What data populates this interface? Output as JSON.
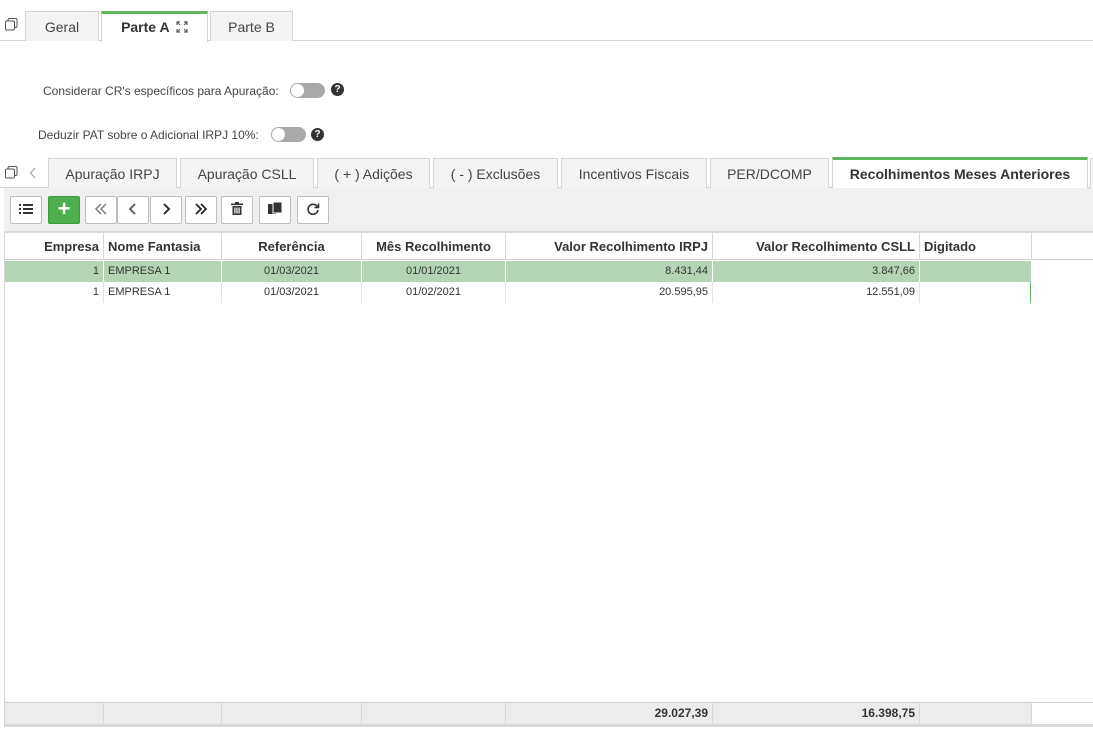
{
  "top_tabs": [
    {
      "label": "Geral",
      "active": false
    },
    {
      "label": "Parte A",
      "active": true
    },
    {
      "label": "Parte B",
      "active": false
    }
  ],
  "options": [
    {
      "label": "Considerar CR's específicos para Apuração:",
      "enabled": false
    },
    {
      "label": "Deduzir PAT sobre o Adicional IRPJ 10%:",
      "enabled": false
    }
  ],
  "help_glyph": "?",
  "sub_tabs": [
    {
      "label": "Apuração IRPJ",
      "active": false
    },
    {
      "label": "Apuração CSLL",
      "active": false
    },
    {
      "label": "( + ) Adições",
      "active": false
    },
    {
      "label": "( - ) Exclusões",
      "active": false
    },
    {
      "label": "Incentivos Fiscais",
      "active": false
    },
    {
      "label": "PER/DCOMP",
      "active": false
    },
    {
      "label": "Recolhimentos Meses Anteriores",
      "active": true
    }
  ],
  "toolbar": {
    "list_icon": "list-icon",
    "add_glyph": "+",
    "first_glyph": "«",
    "prev_glyph": "‹",
    "next_glyph": "›",
    "last_glyph": "»"
  },
  "grid": {
    "columns": [
      "Empresa",
      "Nome Fantasia",
      "Referência",
      "Mês Recolhimento",
      "Valor Recolhimento IRPJ",
      "Valor Recolhimento CSLL",
      "Digitado"
    ],
    "rows": [
      {
        "empresa": "1",
        "nome": "EMPRESA 1",
        "referencia": "01/03/2021",
        "mes": "01/01/2021",
        "irpj": "8.431,44",
        "csll": "3.847,66",
        "digitado": "",
        "selected": true
      },
      {
        "empresa": "1",
        "nome": "EMPRESA 1",
        "referencia": "01/03/2021",
        "mes": "01/02/2021",
        "irpj": "20.595,95",
        "csll": "12.551,09",
        "digitado": "",
        "selected": false
      }
    ],
    "totals": {
      "irpj": "29.027,39",
      "csll": "16.398,75"
    }
  },
  "colors": {
    "accent": "#5cb85c",
    "selected_row": "#b5d4b5",
    "add_button": "#4cae4c"
  }
}
